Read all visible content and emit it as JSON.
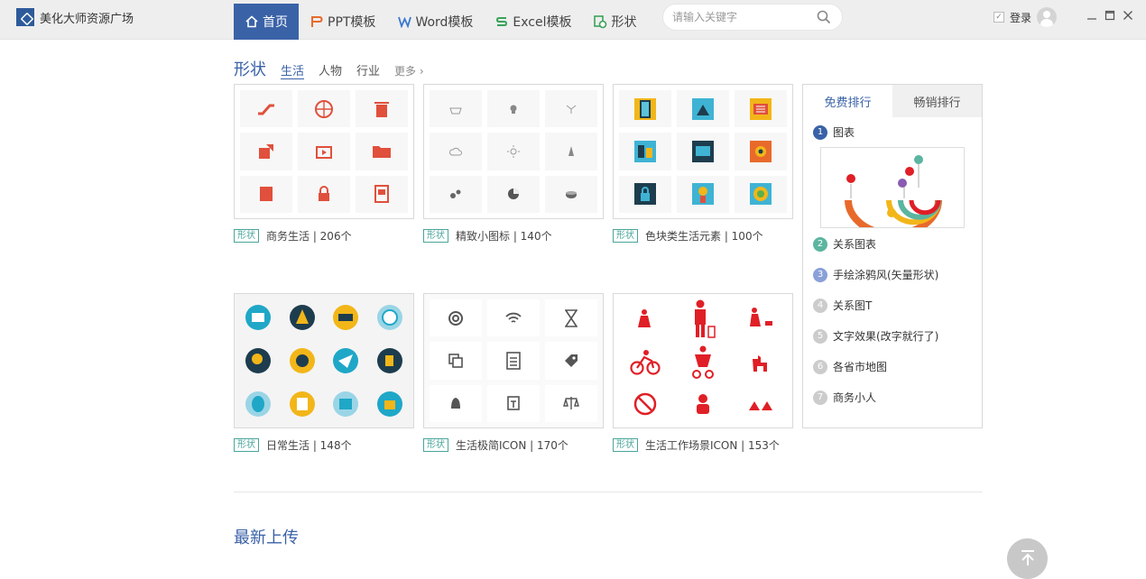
{
  "app": {
    "title": "美化大师资源广场"
  },
  "nav": {
    "items": [
      {
        "label": "首页",
        "icon": "home-icon",
        "active": true
      },
      {
        "label": "PPT模板",
        "icon": "ppt-icon"
      },
      {
        "label": "Word模板",
        "icon": "word-icon"
      },
      {
        "label": "Excel模板",
        "icon": "excel-icon"
      },
      {
        "label": "形状",
        "icon": "shape-icon"
      }
    ]
  },
  "search": {
    "placeholder": "请输入关键字"
  },
  "user": {
    "login_label": "登录"
  },
  "section": {
    "title": "形状",
    "tabs": [
      "生活",
      "人物",
      "行业"
    ],
    "more": "更多"
  },
  "cards": [
    {
      "tag": "形状",
      "caption": "商务生活 | 206个"
    },
    {
      "tag": "形状",
      "caption": "精致小图标 | 140个"
    },
    {
      "tag": "形状",
      "caption": "色块类生活元素 | 100个"
    },
    {
      "tag": "形状",
      "caption": "日常生活 | 148个"
    },
    {
      "tag": "形状",
      "caption": "生活极简ICON | 170个"
    },
    {
      "tag": "形状",
      "caption": "生活工作场景ICON | 153个"
    }
  ],
  "ranking": {
    "tabs": [
      "免费排行",
      "畅销排行"
    ],
    "items": [
      {
        "num": "1",
        "label": "图表",
        "color": "#3a62a7"
      },
      {
        "num": "2",
        "label": "关系图表",
        "color": "#5bb5a0"
      },
      {
        "num": "3",
        "label": "手绘涂鸦风(矢量形状)",
        "color": "#8aa0d8"
      },
      {
        "num": "4",
        "label": "关系图T",
        "color": "#cccccc"
      },
      {
        "num": "5",
        "label": "文字效果(改字就行了)",
        "color": "#cccccc"
      },
      {
        "num": "6",
        "label": "各省市地图",
        "color": "#cccccc"
      },
      {
        "num": "7",
        "label": "商务小人",
        "color": "#cccccc"
      }
    ]
  },
  "latest": {
    "title": "最新上传"
  },
  "colors": {
    "accent": "#3a62a7",
    "tag": "#4aa59b",
    "red": "#e0503c"
  }
}
